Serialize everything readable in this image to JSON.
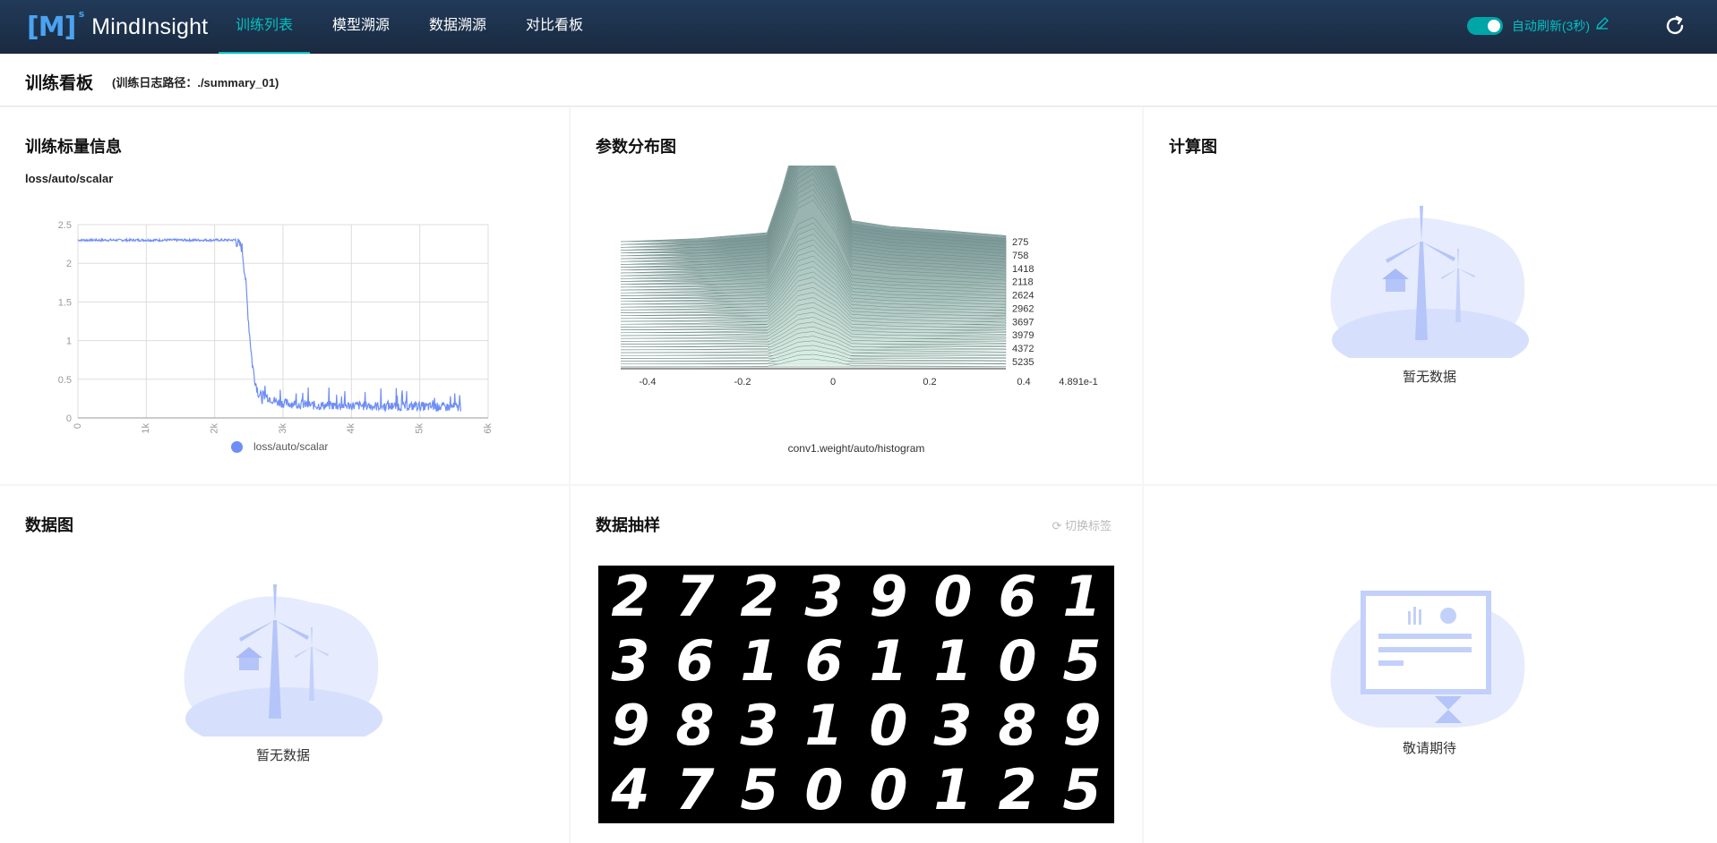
{
  "app": {
    "name": "MindInsight",
    "logo_mark": "[M]",
    "logo_sup": "s"
  },
  "nav": {
    "items": [
      {
        "label": "训练列表",
        "active": true
      },
      {
        "label": "模型溯源",
        "active": false
      },
      {
        "label": "数据溯源",
        "active": false
      },
      {
        "label": "对比看板",
        "active": false
      }
    ]
  },
  "header": {
    "auto_refresh_label": "自动刷新(3秒)",
    "auto_refresh_on": true
  },
  "page": {
    "title": "训练看板",
    "log_path": "(训练日志路径：./summary_01)"
  },
  "cards": {
    "scalar": {
      "title": "训练标量信息",
      "tag": "loss/auto/scalar",
      "legend": "loss/auto/scalar"
    },
    "histogram": {
      "title": "参数分布图",
      "caption": "conv1.weight/auto/histogram",
      "step_labels": [
        "275",
        "758",
        "1418",
        "2118",
        "2624",
        "2962",
        "3697",
        "3979",
        "4372",
        "5235"
      ],
      "x_ticks": [
        "-0.4",
        "-0.2",
        "0",
        "0.2",
        "0.4",
        "4.891e-1"
      ]
    },
    "graph": {
      "title": "计算图",
      "empty_text": "暂无数据"
    },
    "data_graph": {
      "title": "数据图",
      "empty_text": "暂无数据"
    },
    "image": {
      "title": "数据抽样",
      "switch_label": "切换标签",
      "digits": [
        [
          "2",
          "7",
          "2",
          "3",
          "9",
          "0",
          "6",
          "1"
        ],
        [
          "3",
          "6",
          "1",
          "6",
          "1",
          "1",
          "0",
          "5"
        ],
        [
          "9",
          "8",
          "3",
          "1",
          "0",
          "3",
          "8",
          "9"
        ],
        [
          "4",
          "7",
          "5",
          "0",
          "0",
          "1",
          "2",
          "5"
        ]
      ]
    },
    "coming": {
      "empty_text": "敬请期待"
    }
  },
  "chart_data": {
    "type": "line",
    "title": "loss/auto/scalar",
    "series": [
      {
        "name": "loss/auto/scalar",
        "color": "#6e8ef5",
        "x": [
          0,
          500,
          1000,
          1500,
          2000,
          2300,
          2400,
          2450,
          2500,
          2550,
          2600,
          2650,
          2700,
          2800,
          2900,
          3000,
          3200,
          3500,
          4000,
          4500,
          5000,
          5300,
          5600
        ],
        "y": [
          2.3,
          2.3,
          2.3,
          2.3,
          2.3,
          2.3,
          2.2,
          1.8,
          1.2,
          0.7,
          0.45,
          0.3,
          0.25,
          0.2,
          0.15,
          0.13,
          0.12,
          0.1,
          0.1,
          0.09,
          0.09,
          0.08,
          0.08
        ]
      }
    ],
    "xlim": [
      0,
      6000
    ],
    "ylim": [
      0,
      2.5
    ],
    "x_ticks": [
      "0",
      "1k",
      "2k",
      "3k",
      "4k",
      "5k",
      "6k"
    ],
    "y_ticks": [
      "0",
      "0.5",
      "1",
      "1.5",
      "2",
      "2.5"
    ],
    "grid": true,
    "legend": "bottom"
  }
}
